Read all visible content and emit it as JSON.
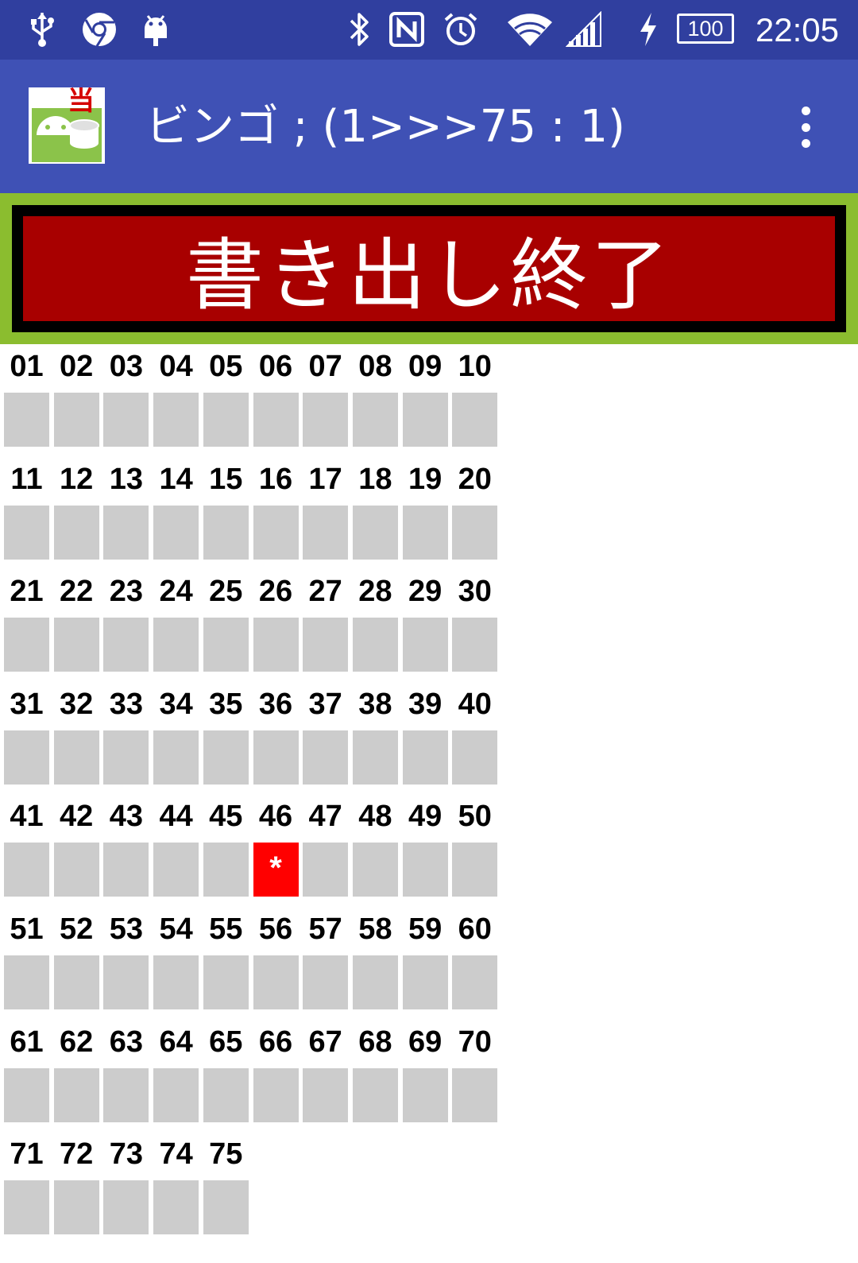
{
  "status_bar": {
    "time": "22:05",
    "battery_level": "100",
    "icons": [
      "usb-icon",
      "chrome-icon",
      "android-debug-icon",
      "bluetooth-icon",
      "nfc-icon",
      "alarm-icon",
      "wifi-icon",
      "signal-icon",
      "charging-icon",
      "battery-icon"
    ]
  },
  "action_bar": {
    "title": "ビンゴ ; (1>>>75 : 1)",
    "app_icon": "bingo-app-icon",
    "app_icon_badge": "当",
    "menu_icon": "overflow-menu-icon"
  },
  "banner": {
    "label": "書き出し終了"
  },
  "grid": {
    "rows": [
      [
        "01",
        "02",
        "03",
        "04",
        "05",
        "06",
        "07",
        "08",
        "09",
        "10"
      ],
      [
        "11",
        "12",
        "13",
        "14",
        "15",
        "16",
        "17",
        "18",
        "19",
        "20"
      ],
      [
        "21",
        "22",
        "23",
        "24",
        "25",
        "26",
        "27",
        "28",
        "29",
        "30"
      ],
      [
        "31",
        "32",
        "33",
        "34",
        "35",
        "36",
        "37",
        "38",
        "39",
        "40"
      ],
      [
        "41",
        "42",
        "43",
        "44",
        "45",
        "46",
        "47",
        "48",
        "49",
        "50"
      ],
      [
        "51",
        "52",
        "53",
        "54",
        "55",
        "56",
        "57",
        "58",
        "59",
        "60"
      ],
      [
        "61",
        "62",
        "63",
        "64",
        "65",
        "66",
        "67",
        "68",
        "69",
        "70"
      ],
      [
        "71",
        "72",
        "73",
        "74",
        "75"
      ]
    ],
    "marked": [
      {
        "number": "46",
        "mark": "*"
      }
    ],
    "colors": {
      "cell": "#cccccc",
      "marked": "#ff0000"
    }
  },
  "colors": {
    "status_bar": "#303f9f",
    "action_bar": "#3f51b5",
    "banner_frame": "#8bbd2f",
    "banner_fill": "#a80000"
  }
}
